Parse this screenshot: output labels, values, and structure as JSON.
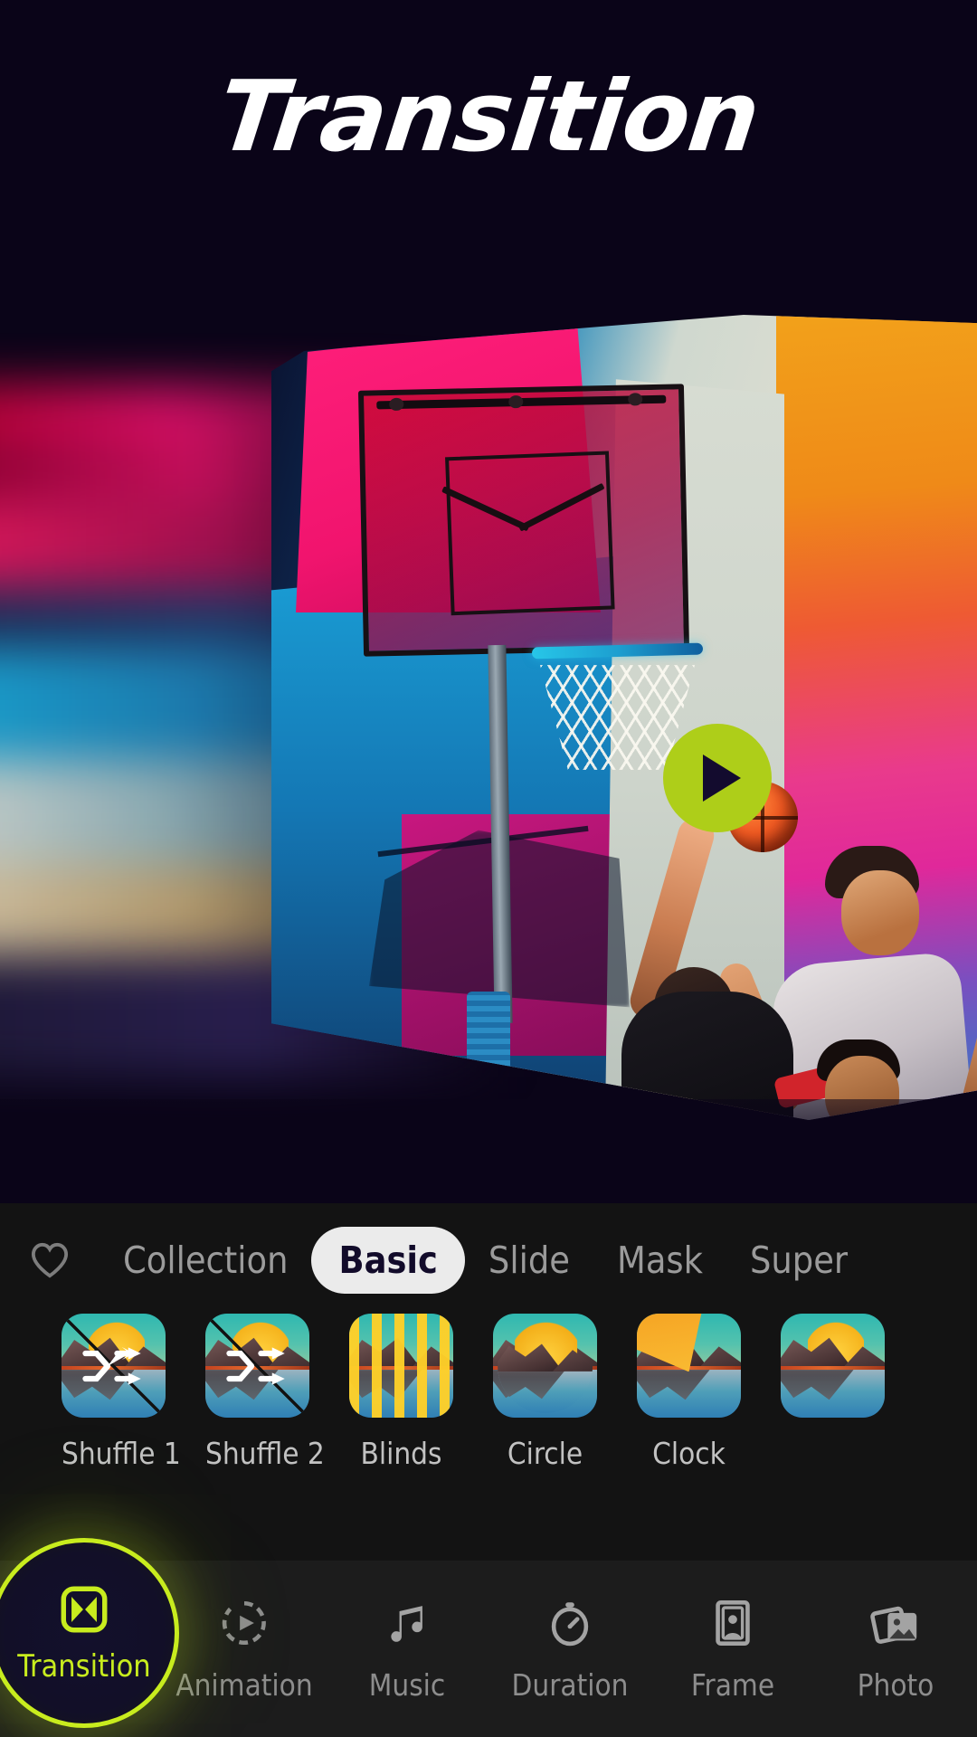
{
  "header": {
    "title": "Transition"
  },
  "preview": {
    "play_button_label": "play-triangle",
    "accent_color": "#aece19",
    "background_color": "#0a0418",
    "scene_description": "basketball-dunk-colorized"
  },
  "panel": {
    "favorites_icon": "heart-icon",
    "categories": [
      {
        "label": "Collection",
        "active": false
      },
      {
        "label": "Basic",
        "active": true
      },
      {
        "label": "Slide",
        "active": false
      },
      {
        "label": "Mask",
        "active": false
      },
      {
        "label": "Super",
        "active": false
      }
    ],
    "transitions": [
      {
        "label": "Shuffle 1",
        "style": "shuffle"
      },
      {
        "label": "Shuffle 2",
        "style": "shuffle"
      },
      {
        "label": "Blinds",
        "style": "blinds"
      },
      {
        "label": "Circle",
        "style": "circle"
      },
      {
        "label": "Clock",
        "style": "clock"
      },
      {
        "label": "",
        "style": "partial"
      }
    ]
  },
  "bottom_nav": {
    "items": [
      {
        "label": "Transition",
        "icon": "transition-icon",
        "active": true
      },
      {
        "label": "Animation",
        "icon": "animation-icon",
        "active": false
      },
      {
        "label": "Music",
        "icon": "music-note-icon",
        "active": false
      },
      {
        "label": "Duration",
        "icon": "stopwatch-icon",
        "active": false
      },
      {
        "label": "Frame",
        "icon": "frame-icon",
        "active": false
      },
      {
        "label": "Photo",
        "icon": "photo-stack-icon",
        "active": false
      }
    ],
    "active_color": "#c8ec1e",
    "inactive_color": "#8d8d8d"
  }
}
